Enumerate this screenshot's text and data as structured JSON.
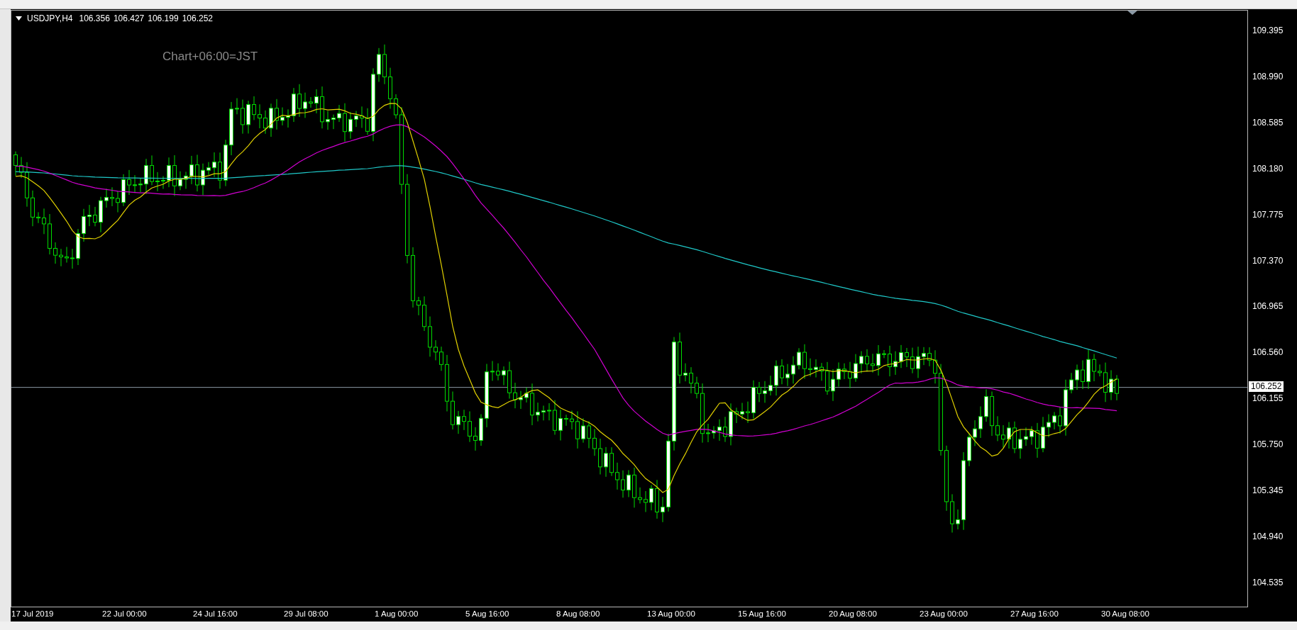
{
  "chart_header": {
    "symbol": "USDJPY,H4",
    "prices": [
      "106.356",
      "106.427",
      "106.199",
      "106.252"
    ]
  },
  "note": "Chart+06:00=JST",
  "price_axis": [
    "109.395",
    "108.990",
    "108.585",
    "108.180",
    "107.775",
    "107.370",
    "106.965",
    "106.560",
    "106.155",
    "105.750",
    "105.345",
    "104.940",
    "104.535"
  ],
  "current_price": "106.252",
  "time_axis": [
    "17 Jul 2019",
    "22 Jul 00:00",
    "24 Jul 16:00",
    "29 Jul 08:00",
    "1 Aug 00:00",
    "5 Aug 16:00",
    "8 Aug 08:00",
    "13 Aug 00:00",
    "15 Aug 16:00",
    "20 Aug 08:00",
    "23 Aug 00:00",
    "27 Aug 16:00",
    "30 Aug 08:00"
  ]
}
